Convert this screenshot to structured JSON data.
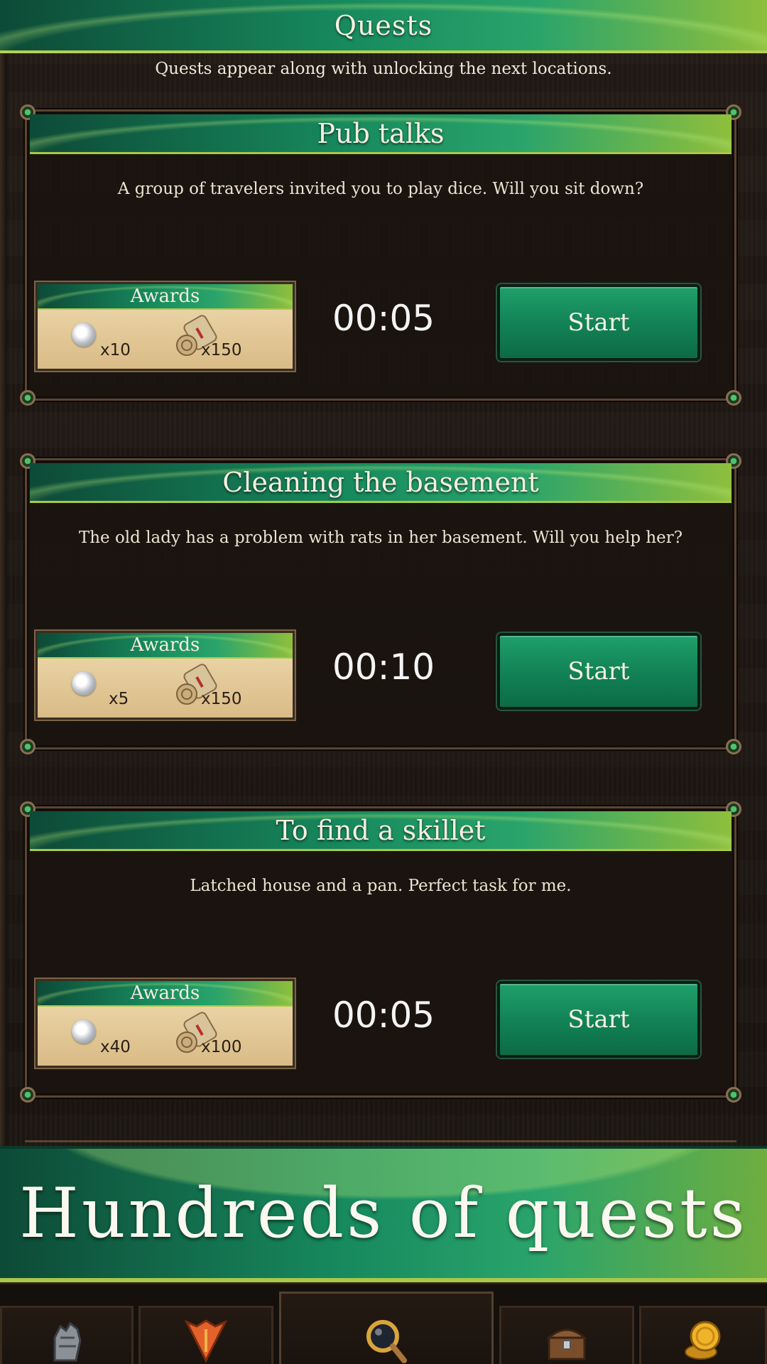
{
  "header": {
    "title": "Quests"
  },
  "subtitle": "Quests appear along with unlocking the next locations.",
  "quests": [
    {
      "title": "Pub talks",
      "description": "A group of travelers invited you to play dice. Will you sit down?",
      "awards_label": "Awards",
      "coin_amount": "x10",
      "xp_amount": "x150",
      "timer": "00:05",
      "button_label": "Start"
    },
    {
      "title": "Cleaning the basement",
      "description": "The old lady has a problem with rats in her basement. Will you help her?",
      "awards_label": "Awards",
      "coin_amount": "x5",
      "xp_amount": "x150",
      "timer": "00:10",
      "button_label": "Start"
    },
    {
      "title": "To find a skillet",
      "description": "Latched house and a pan. Perfect task for me.",
      "awards_label": "Awards",
      "coin_amount": "x40",
      "xp_amount": "x100",
      "timer": "00:05",
      "button_label": "Start"
    }
  ],
  "promo": {
    "text": "Hundreds of quests"
  },
  "nav": {
    "items": [
      {
        "icon": "gauntlet-icon"
      },
      {
        "icon": "emblem-icon"
      },
      {
        "icon": "magnifier-icon",
        "active": true
      },
      {
        "icon": "treasure-chest-icon"
      },
      {
        "icon": "gold-coins-icon"
      }
    ]
  },
  "colors": {
    "banner_dark": "#0d4a37",
    "banner_light": "#8fbf3c",
    "button_green": "#138356",
    "background": "#1c1511",
    "parchment": "#e9d2a4"
  }
}
